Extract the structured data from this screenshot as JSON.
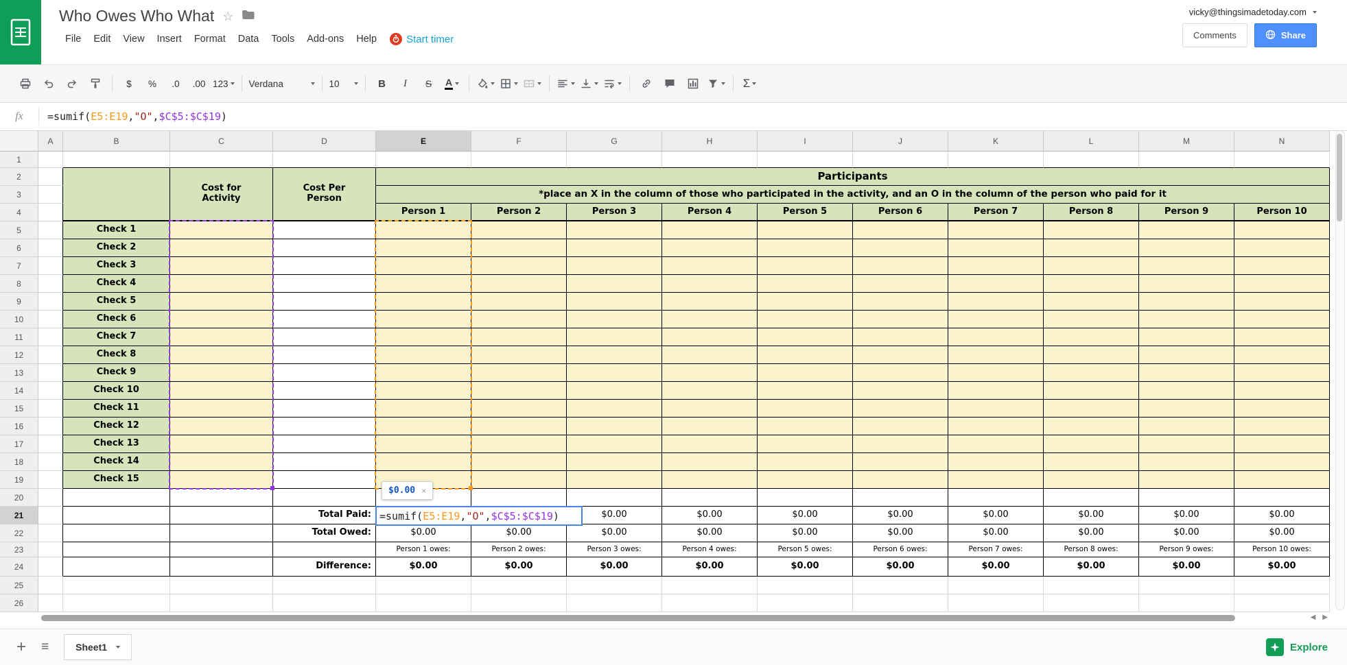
{
  "header": {
    "title": "Who Owes Who What",
    "account": "vicky@thingsimadetoday.com",
    "menus": [
      "File",
      "Edit",
      "View",
      "Insert",
      "Format",
      "Data",
      "Tools",
      "Add-ons",
      "Help"
    ],
    "start_timer": "Start timer",
    "comments_label": "Comments",
    "share_label": "Share"
  },
  "icons": {
    "star": "☆",
    "add_sheet": "+",
    "all_sheets": "≡",
    "scroll_left": "◀",
    "scroll_right": "▶"
  },
  "toolbar": {
    "currency": "$",
    "percent": "%",
    "dec_dec": ".0",
    "dec_inc": ".00",
    "more_formats": "123",
    "font_name": "Verdana",
    "font_size": "10",
    "bold": "B",
    "italic": "I",
    "strike": "S",
    "text_color": "A",
    "functions": "Σ"
  },
  "formula": {
    "label": "fx",
    "parts": [
      {
        "text": "=sumif(",
        "color": "#222222"
      },
      {
        "text": "E5:E19",
        "color": "#f7981d"
      },
      {
        "text": ",",
        "color": "#222222"
      },
      {
        "text": "\"O\"",
        "color": "#a6261d"
      },
      {
        "text": ",",
        "color": "#222222"
      },
      {
        "text": "$C$5:$C$19",
        "color": "#9334e6"
      },
      {
        "text": ")",
        "color": "#222222"
      }
    ]
  },
  "editor": {
    "result_preview": "$0.00",
    "close_label": "×"
  },
  "footer": {
    "sheet_tab": "Sheet1",
    "explore": "Explore"
  },
  "sheet": {
    "columns": [
      "A",
      "B",
      "C",
      "D",
      "E",
      "F",
      "G",
      "H",
      "I",
      "J",
      "K",
      "L",
      "M",
      "N"
    ],
    "rows": 26,
    "selected_column": "E",
    "selected_row": 21,
    "selected_cell": "E21",
    "colors": {
      "green": "#d7e3bb",
      "yellow": "#faf3cd",
      "grid_line": "#d9d9d9",
      "table_line": "#000000",
      "range_c": "#9334e6",
      "range_e": "#f7981d",
      "editor_border": "#4a86e8"
    },
    "fills": [
      {
        "range": "C5:C19",
        "color_key": "yellow"
      },
      {
        "range": "E5:N19",
        "color_key": "yellow"
      }
    ],
    "range_highlights": [
      {
        "range": "C5:C19",
        "color_key": "range_c"
      },
      {
        "range": "E5:E19",
        "color_key": "range_e"
      }
    ],
    "cells": [
      {
        "ref": "B2",
        "rowspan": 3,
        "text": "",
        "style": "green",
        "thick_bottom": true
      },
      {
        "ref": "C2",
        "rowspan": 3,
        "text": "Cost for\nActivity",
        "style": "green_header",
        "thick_bottom": true
      },
      {
        "ref": "D2",
        "rowspan": 3,
        "text": "Cost Per\nPerson",
        "style": "green_header",
        "thick_bottom": true
      },
      {
        "ref": "E2",
        "colspan": 10,
        "text": "Participants",
        "style": "green_title"
      },
      {
        "ref": "E3",
        "colspan": 10,
        "text": "*place an X in the column of those who participated in the activity, and an O in the column of the person who paid for it",
        "style": "green_note"
      },
      {
        "ref": "E4",
        "text": "Person 1",
        "style": "green_header",
        "thick_bottom": true
      },
      {
        "ref": "F4",
        "text": "Person 2",
        "style": "green_header",
        "thick_bottom": true
      },
      {
        "ref": "G4",
        "text": "Person 3",
        "style": "green_header",
        "thick_bottom": true
      },
      {
        "ref": "H4",
        "text": "Person 4",
        "style": "green_header",
        "thick_bottom": true
      },
      {
        "ref": "I4",
        "text": "Person 5",
        "style": "green_header",
        "thick_bottom": true
      },
      {
        "ref": "J4",
        "text": "Person 6",
        "style": "green_header",
        "thick_bottom": true
      },
      {
        "ref": "K4",
        "text": "Person 7",
        "style": "green_header",
        "thick_bottom": true
      },
      {
        "ref": "L4",
        "text": "Person 8",
        "style": "green_header",
        "thick_bottom": true
      },
      {
        "ref": "M4",
        "text": "Person 9",
        "style": "green_header",
        "thick_bottom": true
      },
      {
        "ref": "N4",
        "text": "Person 10",
        "style": "green_header",
        "thick_bottom": true
      },
      {
        "ref": "B5",
        "text": "Check 1",
        "style": "row_label"
      },
      {
        "ref": "B6",
        "text": "Check 2",
        "style": "row_label"
      },
      {
        "ref": "B7",
        "text": "Check 3",
        "style": "row_label"
      },
      {
        "ref": "B8",
        "text": "Check 4",
        "style": "row_label"
      },
      {
        "ref": "B9",
        "text": "Check 5",
        "style": "row_label"
      },
      {
        "ref": "B10",
        "text": "Check 6",
        "style": "row_label"
      },
      {
        "ref": "B11",
        "text": "Check 7",
        "style": "row_label"
      },
      {
        "ref": "B12",
        "text": "Check 8",
        "style": "row_label"
      },
      {
        "ref": "B13",
        "text": "Check 9",
        "style": "row_label"
      },
      {
        "ref": "B14",
        "text": "Check 10",
        "style": "row_label"
      },
      {
        "ref": "B15",
        "text": "Check 11",
        "style": "row_label"
      },
      {
        "ref": "B16",
        "text": "Check 12",
        "style": "row_label"
      },
      {
        "ref": "B17",
        "text": "Check 13",
        "style": "row_label"
      },
      {
        "ref": "B18",
        "text": "Check 14",
        "style": "row_label"
      },
      {
        "ref": "B19",
        "text": "Check 15",
        "style": "row_label"
      },
      {
        "ref": "D21",
        "text": "Total Paid:",
        "style": "total_label"
      },
      {
        "ref": "G21",
        "text": "$0.00",
        "style": "money"
      },
      {
        "ref": "H21",
        "text": "$0.00",
        "style": "money"
      },
      {
        "ref": "I21",
        "text": "$0.00",
        "style": "money"
      },
      {
        "ref": "J21",
        "text": "$0.00",
        "style": "money"
      },
      {
        "ref": "K21",
        "text": "$0.00",
        "style": "money"
      },
      {
        "ref": "L21",
        "text": "$0.00",
        "style": "money"
      },
      {
        "ref": "M21",
        "text": "$0.00",
        "style": "money"
      },
      {
        "ref": "N21",
        "text": "$0.00",
        "style": "money"
      },
      {
        "ref": "D22",
        "text": "Total Owed:",
        "style": "total_label"
      },
      {
        "ref": "E22",
        "text": "$0.00",
        "style": "money"
      },
      {
        "ref": "F22",
        "text": "$0.00",
        "style": "money"
      },
      {
        "ref": "G22",
        "text": "$0.00",
        "style": "money"
      },
      {
        "ref": "H22",
        "text": "$0.00",
        "style": "money"
      },
      {
        "ref": "I22",
        "text": "$0.00",
        "style": "money"
      },
      {
        "ref": "J22",
        "text": "$0.00",
        "style": "money"
      },
      {
        "ref": "K22",
        "text": "$0.00",
        "style": "money"
      },
      {
        "ref": "L22",
        "text": "$0.00",
        "style": "money"
      },
      {
        "ref": "M22",
        "text": "$0.00",
        "style": "money"
      },
      {
        "ref": "N22",
        "text": "$0.00",
        "style": "money"
      },
      {
        "ref": "E23",
        "text": "Person 1 owes:",
        "style": "owes"
      },
      {
        "ref": "F23",
        "text": "Person 2 owes:",
        "style": "owes"
      },
      {
        "ref": "G23",
        "text": "Person 3 owes:",
        "style": "owes"
      },
      {
        "ref": "H23",
        "text": "Person 4 owes:",
        "style": "owes"
      },
      {
        "ref": "I23",
        "text": "Person 5 owes:",
        "style": "owes"
      },
      {
        "ref": "J23",
        "text": "Person 6 owes:",
        "style": "owes"
      },
      {
        "ref": "K23",
        "text": "Person 7 owes:",
        "style": "owes"
      },
      {
        "ref": "L23",
        "text": "Person 8 owes:",
        "style": "owes"
      },
      {
        "ref": "M23",
        "text": "Person 9 owes:",
        "style": "owes"
      },
      {
        "ref": "N23",
        "text": "Person 10 owes:",
        "style": "owes"
      },
      {
        "ref": "D24",
        "text": "Difference:",
        "style": "total_label"
      },
      {
        "ref": "E24",
        "text": "$0.00",
        "style": "money_bold"
      },
      {
        "ref": "F24",
        "text": "$0.00",
        "style": "money_bold"
      },
      {
        "ref": "G24",
        "text": "$0.00",
        "style": "money_bold"
      },
      {
        "ref": "H24",
        "text": "$0.00",
        "style": "money_bold"
      },
      {
        "ref": "I24",
        "text": "$0.00",
        "style": "money_bold"
      },
      {
        "ref": "J24",
        "text": "$0.00",
        "style": "money_bold"
      },
      {
        "ref": "K24",
        "text": "$0.00",
        "style": "money_bold"
      },
      {
        "ref": "L24",
        "text": "$0.00",
        "style": "money_bold"
      },
      {
        "ref": "M24",
        "text": "$0.00",
        "style": "money_bold"
      },
      {
        "ref": "N24",
        "text": "$0.00",
        "style": "money_bold"
      }
    ]
  }
}
